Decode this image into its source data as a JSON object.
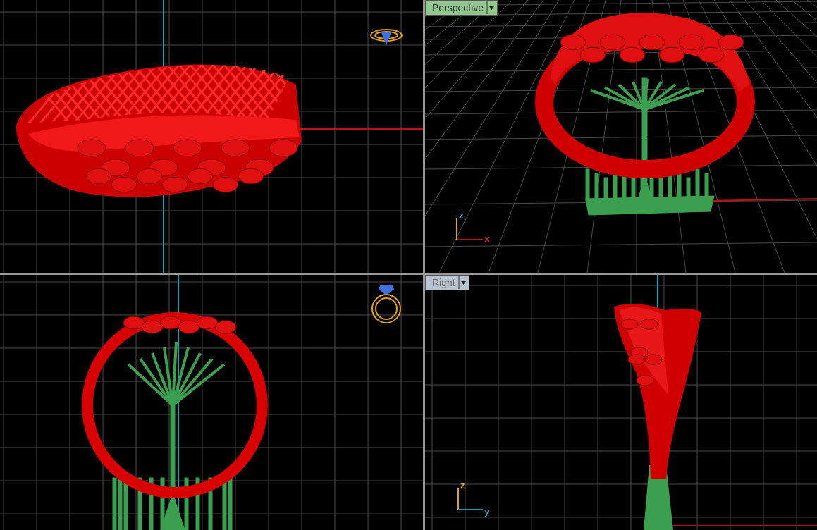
{
  "viewports": [
    {
      "kind": "top"
    },
    {
      "kind": "perspective",
      "tab": {
        "label": "Perspective",
        "selected": true
      },
      "axes": [
        "z",
        "x"
      ]
    },
    {
      "kind": "front"
    },
    {
      "kind": "right",
      "tab": {
        "label": "Right",
        "selected": false
      },
      "axes": [
        "z",
        "y"
      ]
    }
  ]
}
